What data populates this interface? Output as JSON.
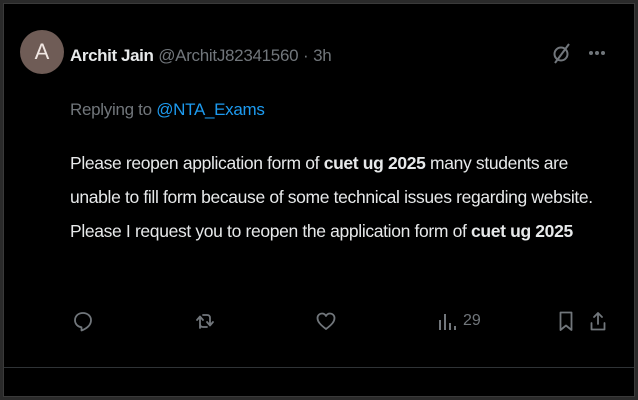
{
  "tweet": {
    "avatar_letter": "A",
    "author_name": "Archit Jain",
    "author_handle": "@ArchitJ82341560",
    "separator": "·",
    "time": "3h",
    "replying_prefix": "Replying to ",
    "replying_handle": "@NTA_Exams",
    "text_parts": [
      "Please reopen application form of ",
      "cuet ug 2025",
      " many students are unable to fill form because of some technical issues regarding website. Please I request you to reopen the application form of ",
      "cuet ug 2025"
    ],
    "views_count": "29"
  },
  "icons": {
    "grok": "grok-icon",
    "more": "more-icon",
    "reply": "reply-icon",
    "retweet": "retweet-icon",
    "like": "like-icon",
    "views": "views-icon",
    "bookmark": "bookmark-icon",
    "share": "share-icon"
  },
  "colors": {
    "background": "#000000",
    "text": "#e7e9ea",
    "muted": "#71767b",
    "accent": "#1d9bf0"
  }
}
